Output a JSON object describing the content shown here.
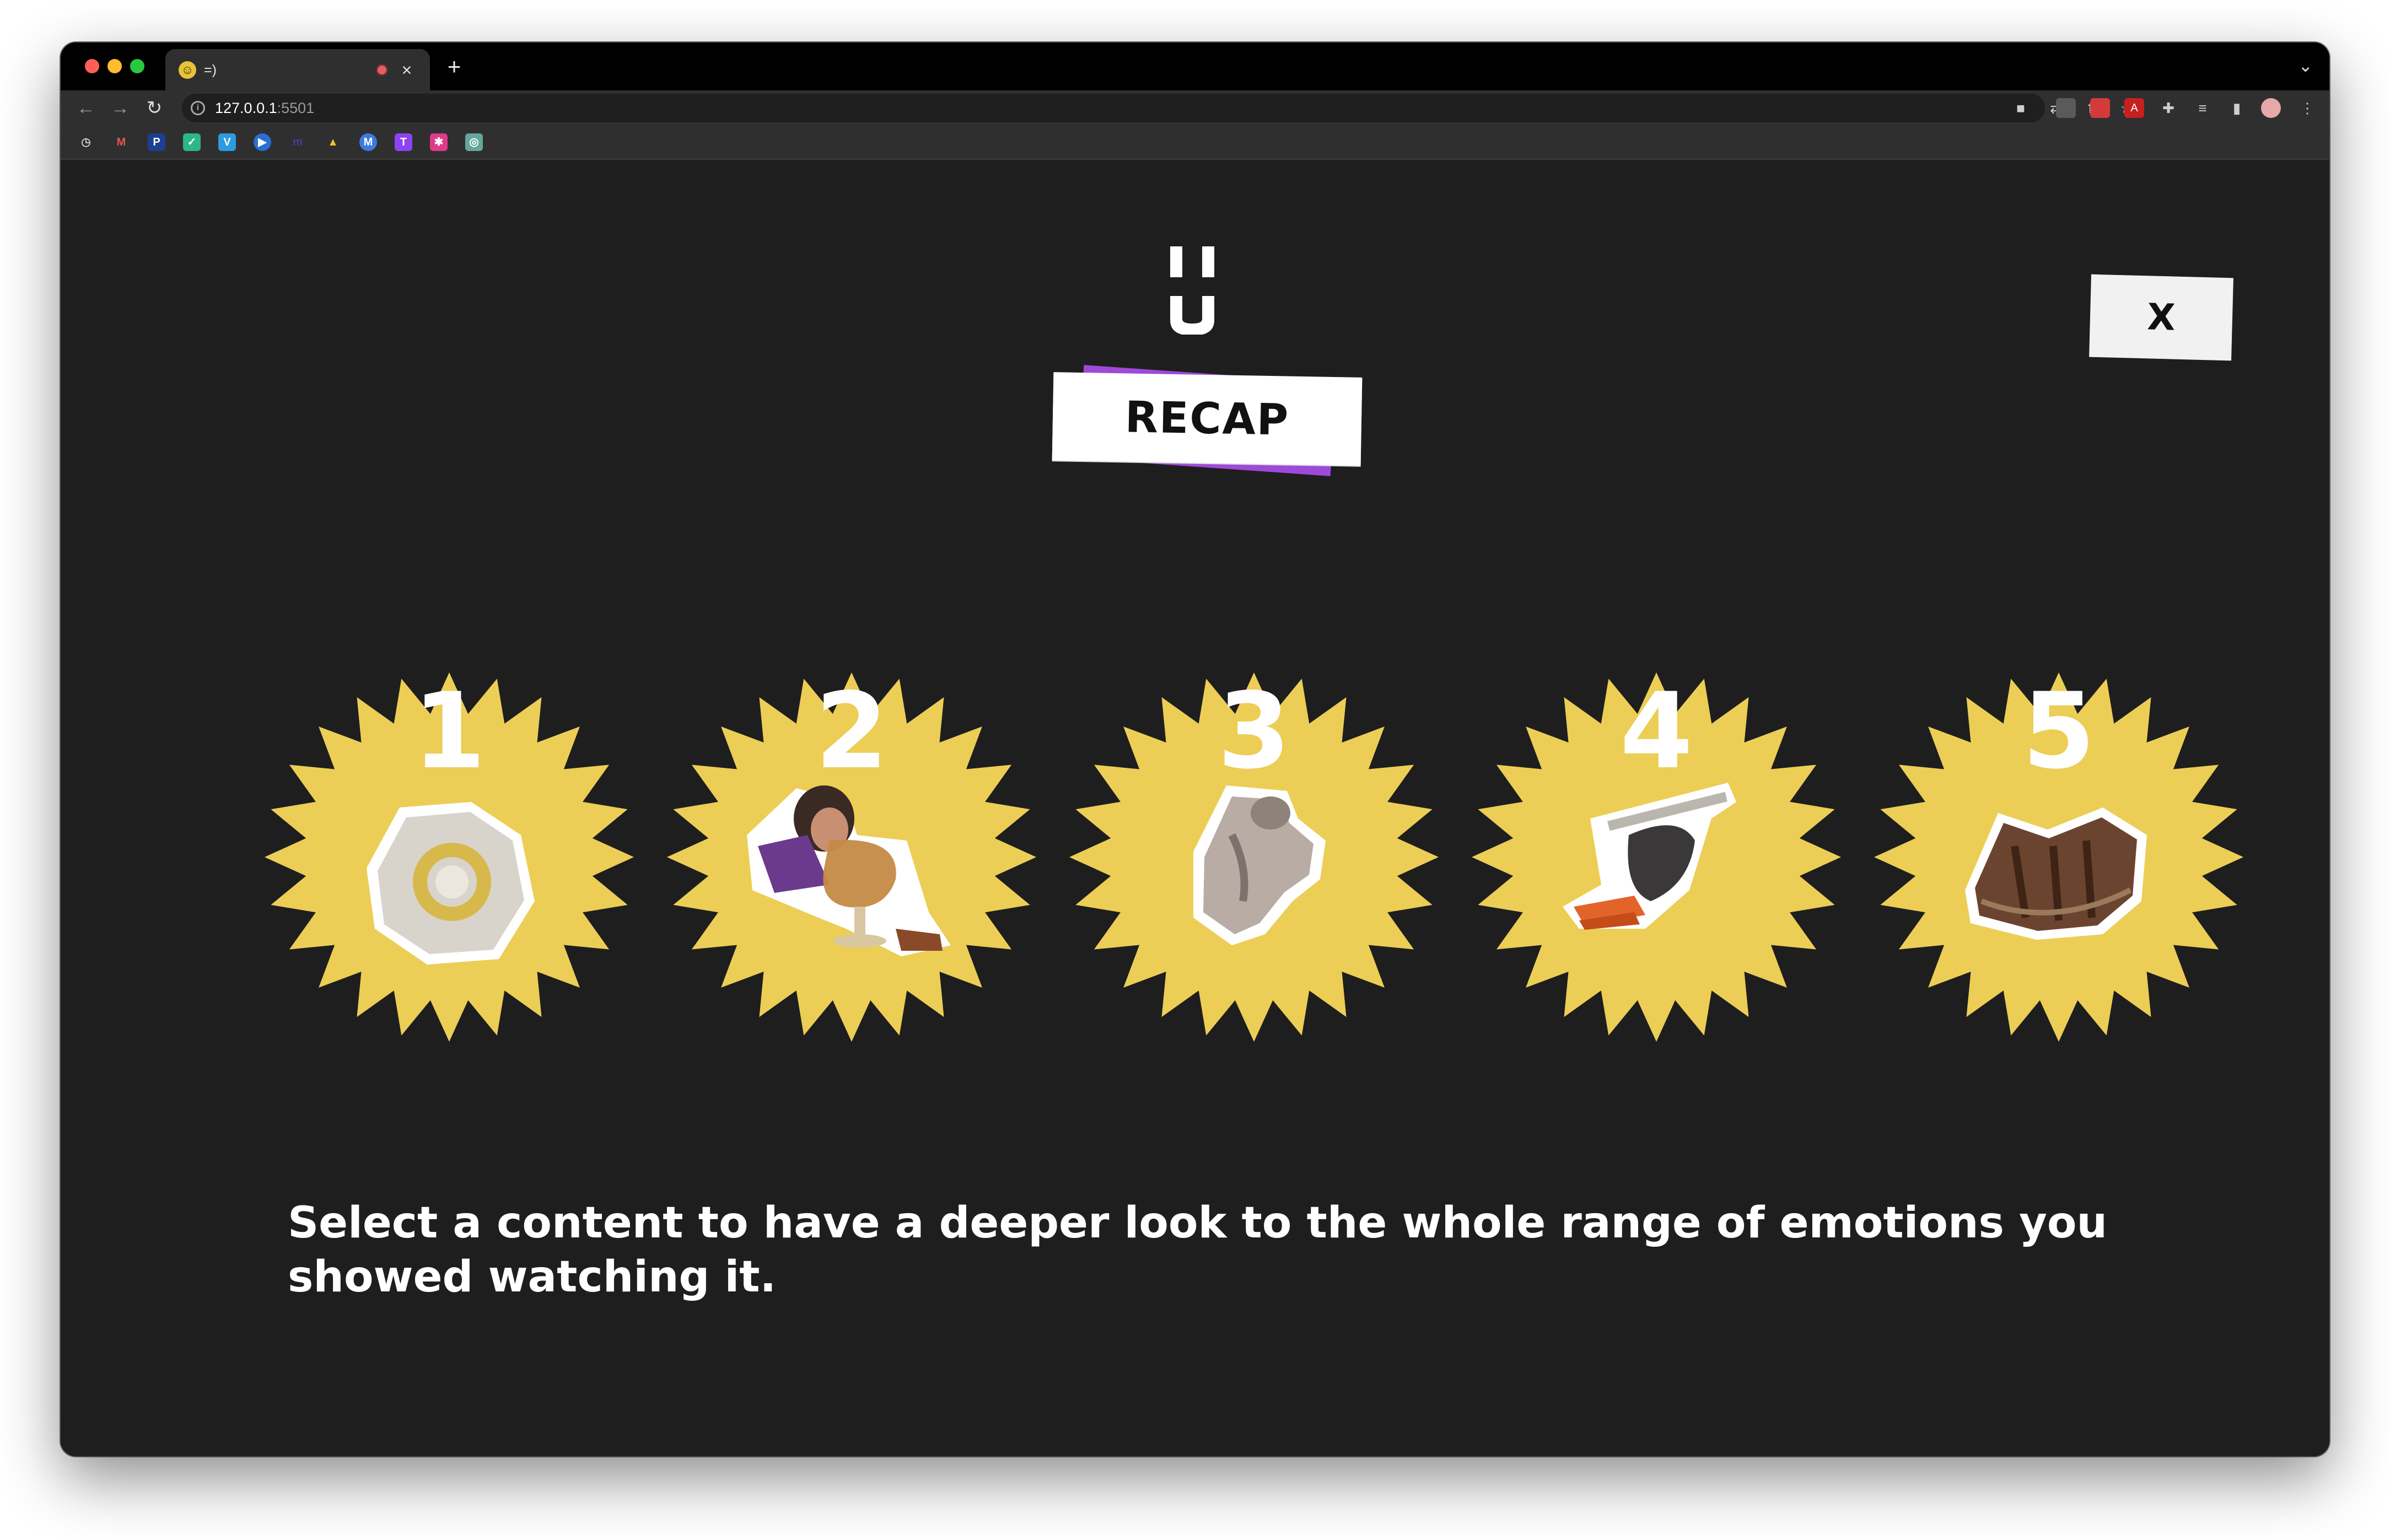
{
  "browser": {
    "tab_title": "=)",
    "tab_favicon": "☺",
    "new_tab_symbol": "+",
    "tab_close_symbol": "×",
    "tab_menu_symbol": "⌄",
    "url_host": "127.0.0.1",
    "url_port": ":5501",
    "nav": {
      "back": "←",
      "forward": "→",
      "reload": "↻"
    },
    "toolbar_icons": [
      "camera-icon",
      "translate-icon",
      "share-icon",
      "star-icon",
      "extension-icon-1",
      "extension-icon-2",
      "pdf-icon",
      "puzzle-icon",
      "reading-list-icon",
      "side-panel-icon",
      "profile-avatar",
      "more-menu-icon"
    ],
    "bookmark_icons": [
      "history-icon",
      "gmail-icon",
      "pr-icon",
      "check-icon",
      "v-icon",
      "play-icon",
      "m-icon",
      "drive-icon",
      "circle-m-icon",
      "twitch-icon",
      "app-icon",
      "openai-icon"
    ]
  },
  "app": {
    "logo_alt": "app-logo",
    "recap_label": "RECAP",
    "close_label": "X",
    "accent_yellow": "#ecce56",
    "accent_purple": "#9e4ad9",
    "background": "#1e1e1e",
    "badges": [
      {
        "number": "1",
        "image": "plate-image"
      },
      {
        "number": "2",
        "image": "woman-with-glass-image"
      },
      {
        "number": "3",
        "image": "cat-jumping-image"
      },
      {
        "number": "4",
        "image": "animal-with-carrots-image"
      },
      {
        "number": "5",
        "image": "cake-image"
      }
    ],
    "instruction": "Select a content to have a deeper look to the whole range of emotions you showed watching it."
  }
}
